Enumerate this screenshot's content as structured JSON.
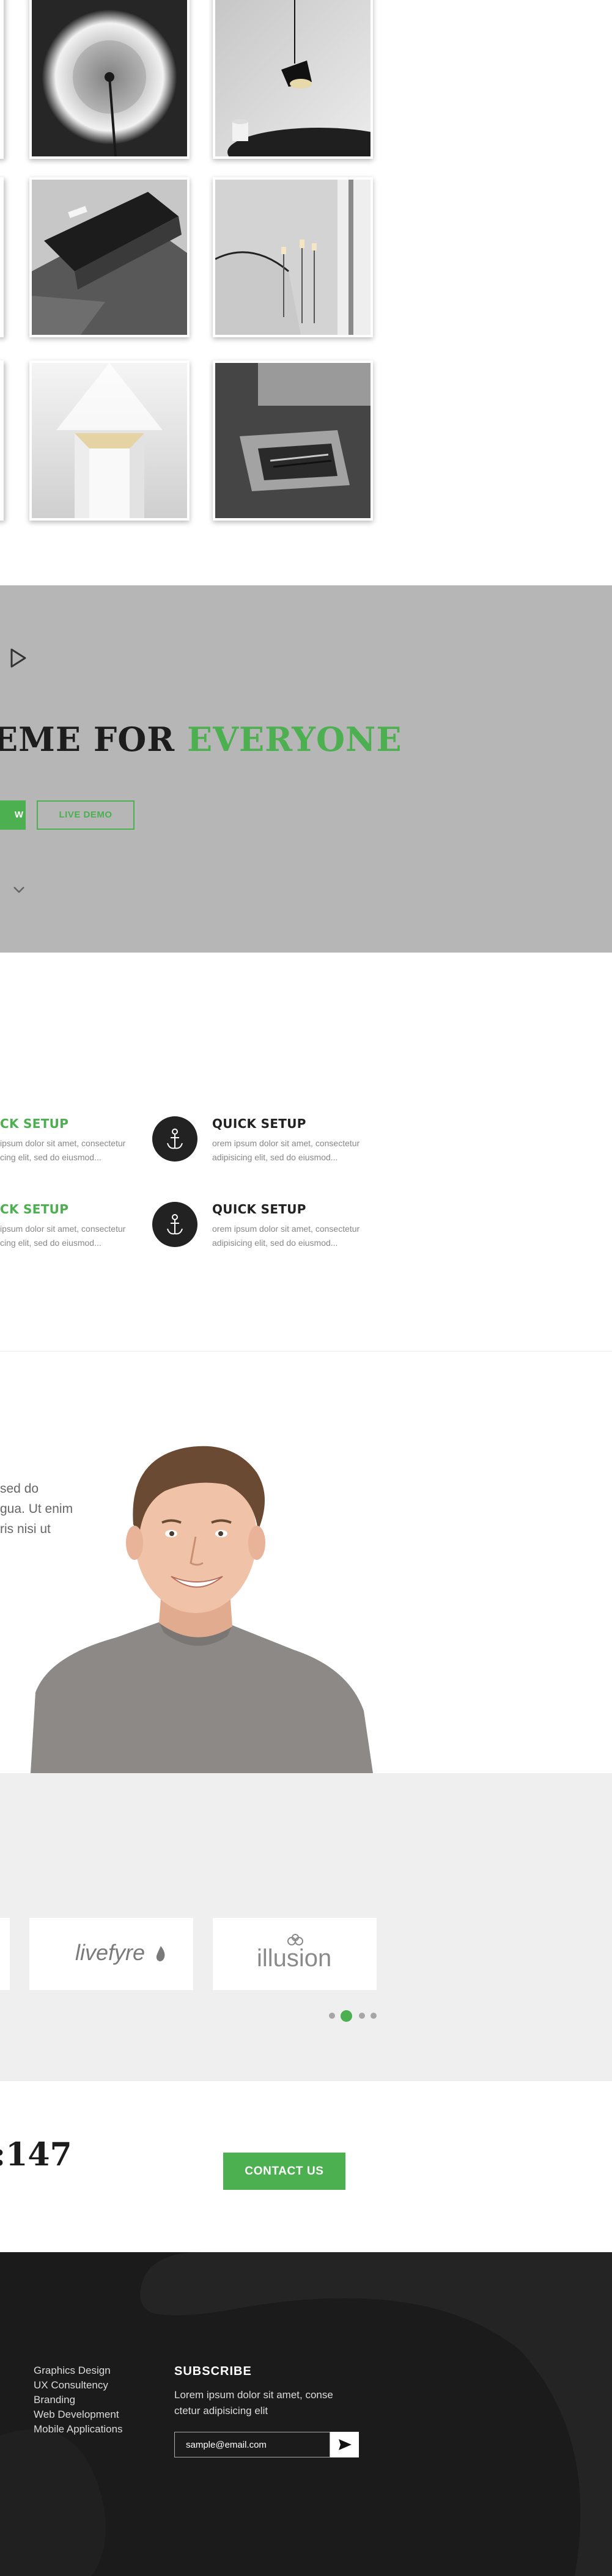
{
  "hero": {
    "title_dark": "EME FOR",
    "title_accent": "EVERYONE",
    "button_partial": "W",
    "button_demo": "LIVE DEMO"
  },
  "features": [
    {
      "title": "CK SETUP",
      "line1": "ipsum dolor sit amet, consectetur",
      "line2": "cing elit, sed do eiusmod..."
    },
    {
      "title": "QUICK SETUP",
      "line1": "orem ipsum dolor sit amet, consectetur",
      "line2": "adipisicing elit, sed do eiusmod..."
    },
    {
      "title": "CK SETUP",
      "line1": "ipsum dolor sit amet, consectetur",
      "line2": "cing elit, sed do eiusmod..."
    },
    {
      "title": "QUICK SETUP",
      "line1": "orem ipsum dolor sit amet, consectetur",
      "line2": "adipisicing elit, sed do eiusmod..."
    }
  ],
  "about": {
    "lines": [
      "sed do",
      "gua. Ut enim",
      "ris nisi ut"
    ]
  },
  "clients": {
    "logos": [
      "livefyre",
      "illusion"
    ],
    "active_slide": 2,
    "slide_count": 4
  },
  "contact": {
    "phone_partial": ":147",
    "button": "CONTACT US"
  },
  "footer": {
    "services": [
      "Graphics Design",
      "UX Consultency",
      "Branding",
      "Web Development",
      "Mobile Applications"
    ],
    "subscribe_title": "SUBSCRIBE",
    "subscribe_text": [
      "Lorem ipsum dolor sit amet, conse",
      "ctetur adipisicing elit"
    ],
    "email_placeholder": "sample@email.com"
  },
  "colors": {
    "accent": "#4caf50",
    "hero_bg": "#b6b6b6",
    "footer_bg": "#1b1b1c",
    "clients_bg": "#efefef"
  }
}
